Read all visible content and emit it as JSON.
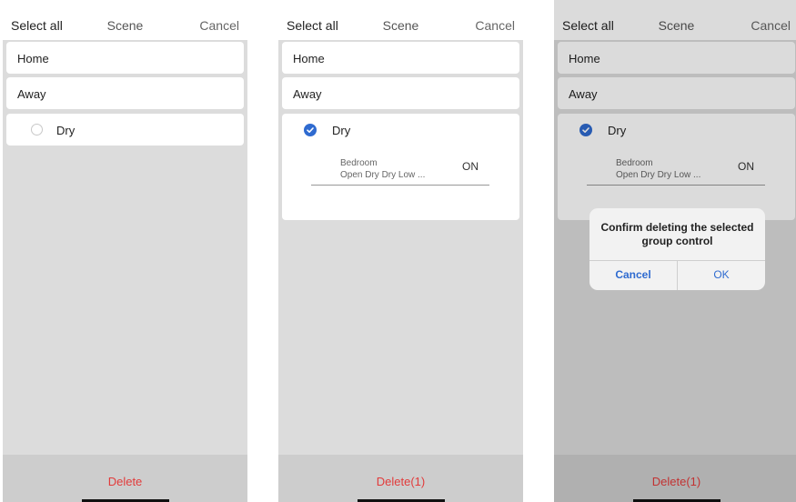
{
  "screens": [
    {
      "header": {
        "select_all": "Select all",
        "title": "Scene",
        "cancel": "Cancel"
      },
      "scenes": [
        "Home",
        "Away"
      ],
      "group": {
        "title": "Dry",
        "selected": false
      },
      "footer": {
        "delete": "Delete"
      }
    },
    {
      "header": {
        "select_all": "Select all",
        "title": "Scene",
        "cancel": "Cancel"
      },
      "scenes": [
        "Home",
        "Away"
      ],
      "group": {
        "title": "Dry",
        "selected": true,
        "device": {
          "room": "Bedroom",
          "settings": "Open Dry Dry Low ...",
          "state": "ON"
        }
      },
      "footer": {
        "delete": "Delete(1)"
      }
    },
    {
      "header": {
        "select_all": "Select all",
        "title": "Scene",
        "cancel": "Cancel"
      },
      "scenes": [
        "Home",
        "Away"
      ],
      "group": {
        "title": "Dry",
        "selected": true,
        "device": {
          "room": "Bedroom",
          "settings": "Open Dry Dry Low ...",
          "state": "ON"
        }
      },
      "footer": {
        "delete": "Delete(1)"
      },
      "dialog": {
        "message": "Confirm deleting the selected group control",
        "cancel": "Cancel",
        "ok": "OK"
      }
    }
  ],
  "colors": {
    "accent": "#2f6bd0",
    "delete": "#e23b3b",
    "background": "#dcdcdc"
  },
  "icons": {
    "selected": "check-circle-icon",
    "unselected": "radio-empty-icon"
  }
}
